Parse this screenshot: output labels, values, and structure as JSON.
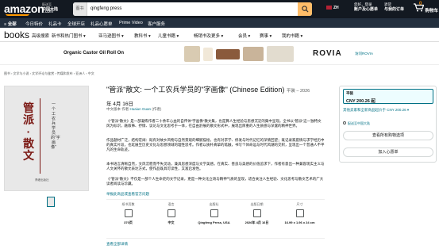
{
  "header": {
    "logo": "amazon",
    "logo_suffix": ".com",
    "deliver_line1": "配送至",
    "deliver_line2": "中国大陆",
    "search_category": "图书",
    "search_query": "qingfeng press",
    "language": "ZH",
    "account_line1": "您好，登录",
    "account_line2": "账户及心愿单",
    "orders_line1": "退货",
    "orders_line2": "与我的订单",
    "cart_count": "0",
    "cart_label": "购物车"
  },
  "navbar": {
    "items": [
      "≡ 全部",
      "今日特价",
      "礼品卡",
      "全球开店",
      "礼品心愿单",
      "Prime Video",
      "客户服务"
    ]
  },
  "subnav": {
    "title": "books",
    "items": [
      "高级搜索",
      "新书和热门图书 ▾",
      "亚马逊图书 ▾",
      "教科书 ▾",
      "儿童书籍 ▾",
      "畅销书及更多 ▾",
      "会员 ▾",
      "赛事 ▾",
      "我的书籍 ▾"
    ]
  },
  "ad": {
    "left_text": "Organic Castor Oil Roll On",
    "brand": "ROVIA",
    "right_text": "访问ROVIA"
  },
  "breadcrumb": "图书 › 文学与小说 › 文学评论与鉴赏 › 传媒和发布 › 亚洲人 › 中文",
  "cover": {
    "title_chars": "管派·散文",
    "subtitle": "一个工农兵学员的\"字画像\"",
    "publisher": "青峰出版社"
  },
  "product": {
    "title": "\"管派\"散文: 一个工农兵学员的\"字画像\" (Chinese Edition)",
    "format_suffix": "平装 – 2026",
    "date": "年 4月 16日",
    "author_prefix": "中文版本",
    "author_mid": "作者",
    "author_name": "Huaiun Guan",
    "author_role": "(作者)",
    "description": [
      "《\"管派\"散文》是一部凝练作者二十余年心血的自传体\"字画像\"散文集，也是算人生经验与思想沉淀的集中呈现。全书以\"管派\"这一独特文风为标识，融叙事、抒情、议论与文化思考于一体，在自由舒展的散文形式中，展现出厚重的人生质感与深邃的精神世界。",
      "作品题材广泛，结构宏阔：既有对故乡风物与自然景观的细腻描绘，也有对求学、修发与时代记忆的深情回望；既记录家庭情与求学经历中的真实片段，也延展至历史文化与思想领域的理性思考。作者以质朴真挚的笔触，书写个体命运与时代风潮的交织，呈现出一个普通人不平凡的生命轨迹。",
      "本书语言清晰自然，文风沉稳而不失灵动，兼具思想深度与文学美感。在真实、善良与美感的价值追求下，作者有意出一种兼容现实主义与人文关怀的散文表达方式，使作品既具可读性，又富启发性。",
      "《\"管派\"散文》不仅是一部个人生命史的文学记录，更是一种文化立场与精神气质的呈现，适合关注人生经验、文化思考与散文艺术的广大读者阅读与珍藏。"
    ],
    "edit_link": "举报此商品或查看官方问题"
  },
  "details": [
    {
      "label": "纸书页数",
      "value": "370页"
    },
    {
      "label": "语言",
      "value": "中文"
    },
    {
      "label": "出版社",
      "value": "Qingfeng Press, USA"
    },
    {
      "label": "出版日期",
      "value": "2026年 4月 16日"
    },
    {
      "label": "尺寸",
      "value": "16.99 x 1.96 x 24 cm"
    }
  ],
  "all_details_link": "查看全部详情",
  "buybox": {
    "format_label": "平装",
    "price": "CNY 200.26 起",
    "other_sellers": "其他卖家和全新商品起价于 CNY 200.26 ▾",
    "location": "配送至中国大陆",
    "btn_options": "查看所有购物选项",
    "btn_list": "加入心愿单"
  }
}
